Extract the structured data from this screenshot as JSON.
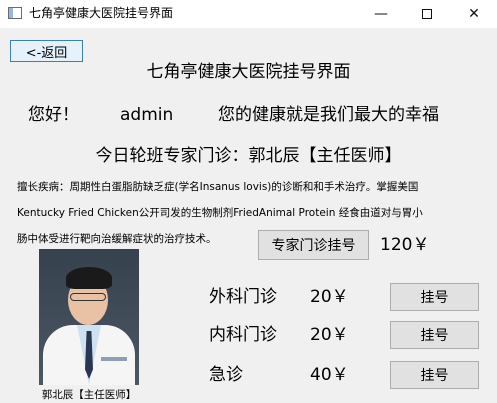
{
  "window": {
    "title": "七角亭健康大医院挂号界面",
    "controls": {
      "minimize": "—",
      "close": "✕"
    }
  },
  "back_button": {
    "label": "<-返回"
  },
  "page_title": "七角亭健康大医院挂号界面",
  "greeting": {
    "hello": "您好！",
    "username": "admin",
    "slogan": "您的健康就是我们最大的幸福"
  },
  "expert_duty": "今日轮班专家门诊：郭北辰【主任医师】",
  "specialty": [
    "擅长疾病：周期性白蛋脂肪缺乏症(学名Insanus lovis)的诊断和和手术治疗。掌握美国",
    "Kentucky Fried Chicken公开司发的生物制剂FriedAnimal Protein 经食由道对与胃小",
    "肠中体受进行靶向治缓解症状的治疗技术。"
  ],
  "expert_register": {
    "label": "专家门诊挂号",
    "fee": "120￥"
  },
  "doctor_photo": {
    "caption": "郭北辰【主任医师】"
  },
  "departments": [
    {
      "name": "外科门诊",
      "fee": "20￥",
      "button": "挂号"
    },
    {
      "name": "内科门诊",
      "fee": "20￥",
      "button": "挂号"
    },
    {
      "name": "急诊",
      "fee": "40￥",
      "button": "挂号"
    }
  ]
}
